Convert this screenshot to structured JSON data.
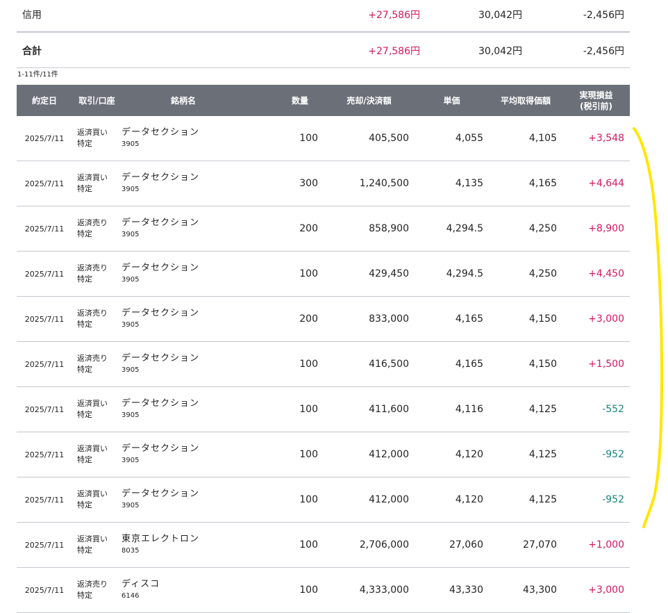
{
  "summary": {
    "credit": {
      "label": "信用",
      "gain": "+27,586円",
      "loss": "30,042円",
      "net": "-2,456円"
    },
    "total": {
      "label": "合計",
      "gain": "+27,586円",
      "loss": "30,042円",
      "net": "-2,456円"
    }
  },
  "result_count": "1-11件/11件",
  "table": {
    "headers": {
      "date": "約定日",
      "type": "取引/口座",
      "name": "銘柄名",
      "qty": "数量",
      "amount": "売却/決済額",
      "price": "単価",
      "avg": "平均取得価額",
      "pl_line1": "実現損益",
      "pl_line2": "(税引前)"
    },
    "rows": [
      {
        "date": "2025/7/11",
        "trade": "返済買い",
        "account": "特定",
        "name": "データセクション",
        "code": "3905",
        "qty": "100",
        "amount": "405,500",
        "price": "4,055",
        "avg": "4,105",
        "pl": "+3,548",
        "sign": "pos"
      },
      {
        "date": "2025/7/11",
        "trade": "返済買い",
        "account": "特定",
        "name": "データセクション",
        "code": "3905",
        "qty": "300",
        "amount": "1,240,500",
        "price": "4,135",
        "avg": "4,165",
        "pl": "+4,644",
        "sign": "pos"
      },
      {
        "date": "2025/7/11",
        "trade": "返済売り",
        "account": "特定",
        "name": "データセクション",
        "code": "3905",
        "qty": "200",
        "amount": "858,900",
        "price": "4,294.5",
        "avg": "4,250",
        "pl": "+8,900",
        "sign": "pos"
      },
      {
        "date": "2025/7/11",
        "trade": "返済売り",
        "account": "特定",
        "name": "データセクション",
        "code": "3905",
        "qty": "100",
        "amount": "429,450",
        "price": "4,294.5",
        "avg": "4,250",
        "pl": "+4,450",
        "sign": "pos"
      },
      {
        "date": "2025/7/11",
        "trade": "返済売り",
        "account": "特定",
        "name": "データセクション",
        "code": "3905",
        "qty": "200",
        "amount": "833,000",
        "price": "4,165",
        "avg": "4,150",
        "pl": "+3,000",
        "sign": "pos"
      },
      {
        "date": "2025/7/11",
        "trade": "返済売り",
        "account": "特定",
        "name": "データセクション",
        "code": "3905",
        "qty": "100",
        "amount": "416,500",
        "price": "4,165",
        "avg": "4,150",
        "pl": "+1,500",
        "sign": "pos"
      },
      {
        "date": "2025/7/11",
        "trade": "返済買い",
        "account": "特定",
        "name": "データセクション",
        "code": "3905",
        "qty": "100",
        "amount": "411,600",
        "price": "4,116",
        "avg": "4,125",
        "pl": "-552",
        "sign": "neg"
      },
      {
        "date": "2025/7/11",
        "trade": "返済買い",
        "account": "特定",
        "name": "データセクション",
        "code": "3905",
        "qty": "100",
        "amount": "412,000",
        "price": "4,120",
        "avg": "4,125",
        "pl": "-952",
        "sign": "neg"
      },
      {
        "date": "2025/7/11",
        "trade": "返済買い",
        "account": "特定",
        "name": "データセクション",
        "code": "3905",
        "qty": "100",
        "amount": "412,000",
        "price": "4,120",
        "avg": "4,125",
        "pl": "-952",
        "sign": "neg"
      },
      {
        "date": "2025/7/11",
        "trade": "返済買い",
        "account": "特定",
        "name": "東京エレクトロン",
        "code": "8035",
        "qty": "100",
        "amount": "2,706,000",
        "price": "27,060",
        "avg": "27,070",
        "pl": "+1,000",
        "sign": "pos"
      },
      {
        "date": "2025/7/11",
        "trade": "返済売り",
        "account": "特定",
        "name": "ディスコ",
        "code": "6146",
        "qty": "100",
        "amount": "4,333,000",
        "price": "43,330",
        "avg": "43,300",
        "pl": "+3,000",
        "sign": "pos"
      }
    ]
  },
  "colors": {
    "header_bg": "#6b6f78",
    "positive": "#d6175c",
    "negative": "#18857d",
    "annotation": "#ffe600"
  }
}
